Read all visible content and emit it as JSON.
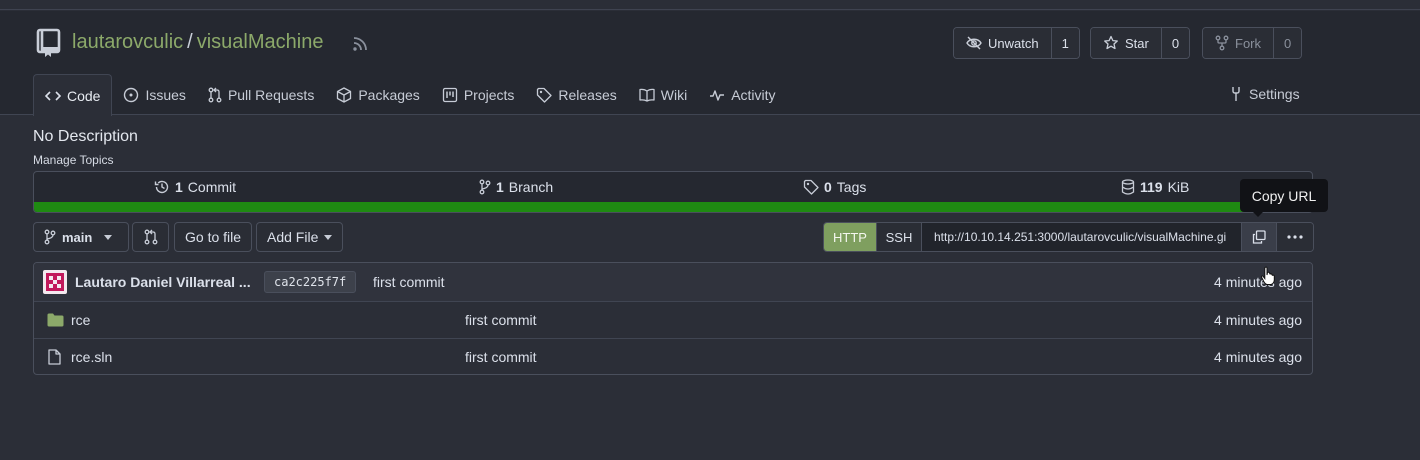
{
  "repo": {
    "owner": "lautarovculic",
    "separator": "/",
    "name": "visualMachine"
  },
  "actions": {
    "watch": {
      "label": "Unwatch",
      "count": "1"
    },
    "star": {
      "label": "Star",
      "count": "0"
    },
    "fork": {
      "label": "Fork",
      "count": "0"
    }
  },
  "tabs": {
    "code": "Code",
    "issues": "Issues",
    "pull_requests": "Pull Requests",
    "packages": "Packages",
    "projects": "Projects",
    "releases": "Releases",
    "wiki": "Wiki",
    "activity": "Activity",
    "settings": "Settings"
  },
  "description": "No Description",
  "manage_topics": "Manage Topics",
  "stats": {
    "commits": {
      "count": "1",
      "label": "Commit"
    },
    "branches": {
      "count": "1",
      "label": "Branch"
    },
    "tags": {
      "count": "0",
      "label": "Tags"
    },
    "size": {
      "count": "119",
      "label": "KiB"
    }
  },
  "language_bar_color": "#1f8a12",
  "tooltip": "Copy URL",
  "toolbar": {
    "branch": "main",
    "go_to_file": "Go to file",
    "add_file": "Add File"
  },
  "clone": {
    "http_label": "HTTP",
    "ssh_label": "SSH",
    "url": "http://10.10.14.251:3000/lautarovculic/visualMachine.gi"
  },
  "latest_commit": {
    "author": "Lautaro Daniel Villarreal ...",
    "sha": "ca2c225f7f",
    "message": "first commit",
    "time": "4 minutes ago"
  },
  "files": [
    {
      "name": "rce",
      "type": "folder",
      "message": "first commit",
      "time": "4 minutes ago"
    },
    {
      "name": "rce.sln",
      "type": "file",
      "message": "first commit",
      "time": "4 minutes ago"
    }
  ],
  "icons": [
    "repo-icon",
    "rss-icon",
    "eye-slash-icon",
    "star-icon",
    "fork-icon",
    "code-icon",
    "issue-icon",
    "pull-request-icon",
    "package-icon",
    "project-icon",
    "tag-icon",
    "book-icon",
    "pulse-icon",
    "tools-icon",
    "history-icon",
    "branch-icon",
    "database-icon",
    "copy-icon",
    "kebab-icon",
    "folder-icon",
    "file-icon"
  ]
}
